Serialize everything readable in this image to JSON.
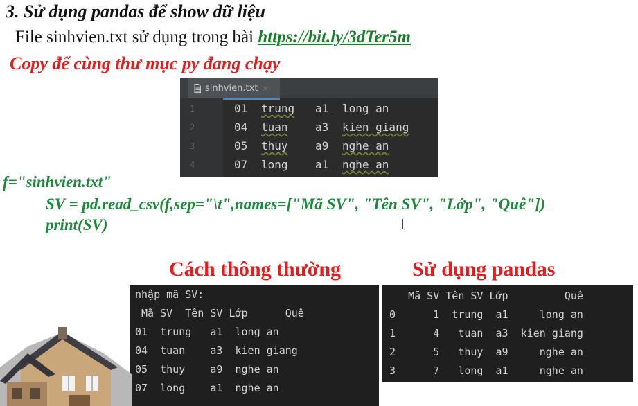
{
  "slide": {
    "title": "3. Sử dụng pandas để show dữ liệu",
    "file_prefix": "File sinhvien.txt sử dụng trong bài ",
    "file_link": "https://bit.ly/3dTer5m",
    "copy_note": "Copy để cùng thư mục py đang chạy"
  },
  "editor": {
    "tab_label": "sinhvien.txt",
    "close_glyph": "×",
    "lines": [
      {
        "num": "1",
        "id": "01",
        "name": "trung",
        "cls": "a1",
        "home": "long an"
      },
      {
        "num": "2",
        "id": "04",
        "name": "tuan",
        "cls": "a3",
        "home": "kien giang"
      },
      {
        "num": "3",
        "id": "05",
        "name": "thuy",
        "cls": "a9",
        "home": "nghe an"
      },
      {
        "num": "4",
        "id": "07",
        "name": "long",
        "cls": "a1",
        "home": "nghe an"
      }
    ]
  },
  "code": {
    "line1": "f=\"sinhvien.txt\"",
    "line2": "SV = pd.read_csv(f,sep=\"\\t\",names=[\"Mã  SV\", \"Tên SV\", \"Lớp\", \"Quê\"])",
    "line3": "print(SV)"
  },
  "headings": {
    "normal": "Cách thông thường",
    "pandas": "Sử dụng pandas"
  },
  "console_normal": {
    "prompt": "nhập mã SV:",
    "header": " Mã SV  Tên SV Lớp      Quê",
    "rows": [
      "01  trung   a1  long an",
      "04  tuan    a3  kien giang",
      "05  thuy    a9  nghe an",
      "07  long    a1  nghe an"
    ]
  },
  "console_pandas": {
    "header": "   Mã SV Tên SV Lớp         Quê",
    "rows": [
      "0      1  trung  a1     long an",
      "1      4   tuan  a3  kien giang",
      "2      5   thuy  a9     nghe an",
      "3      7   long  a1     nghe an"
    ]
  },
  "cursor_glyph": "I"
}
